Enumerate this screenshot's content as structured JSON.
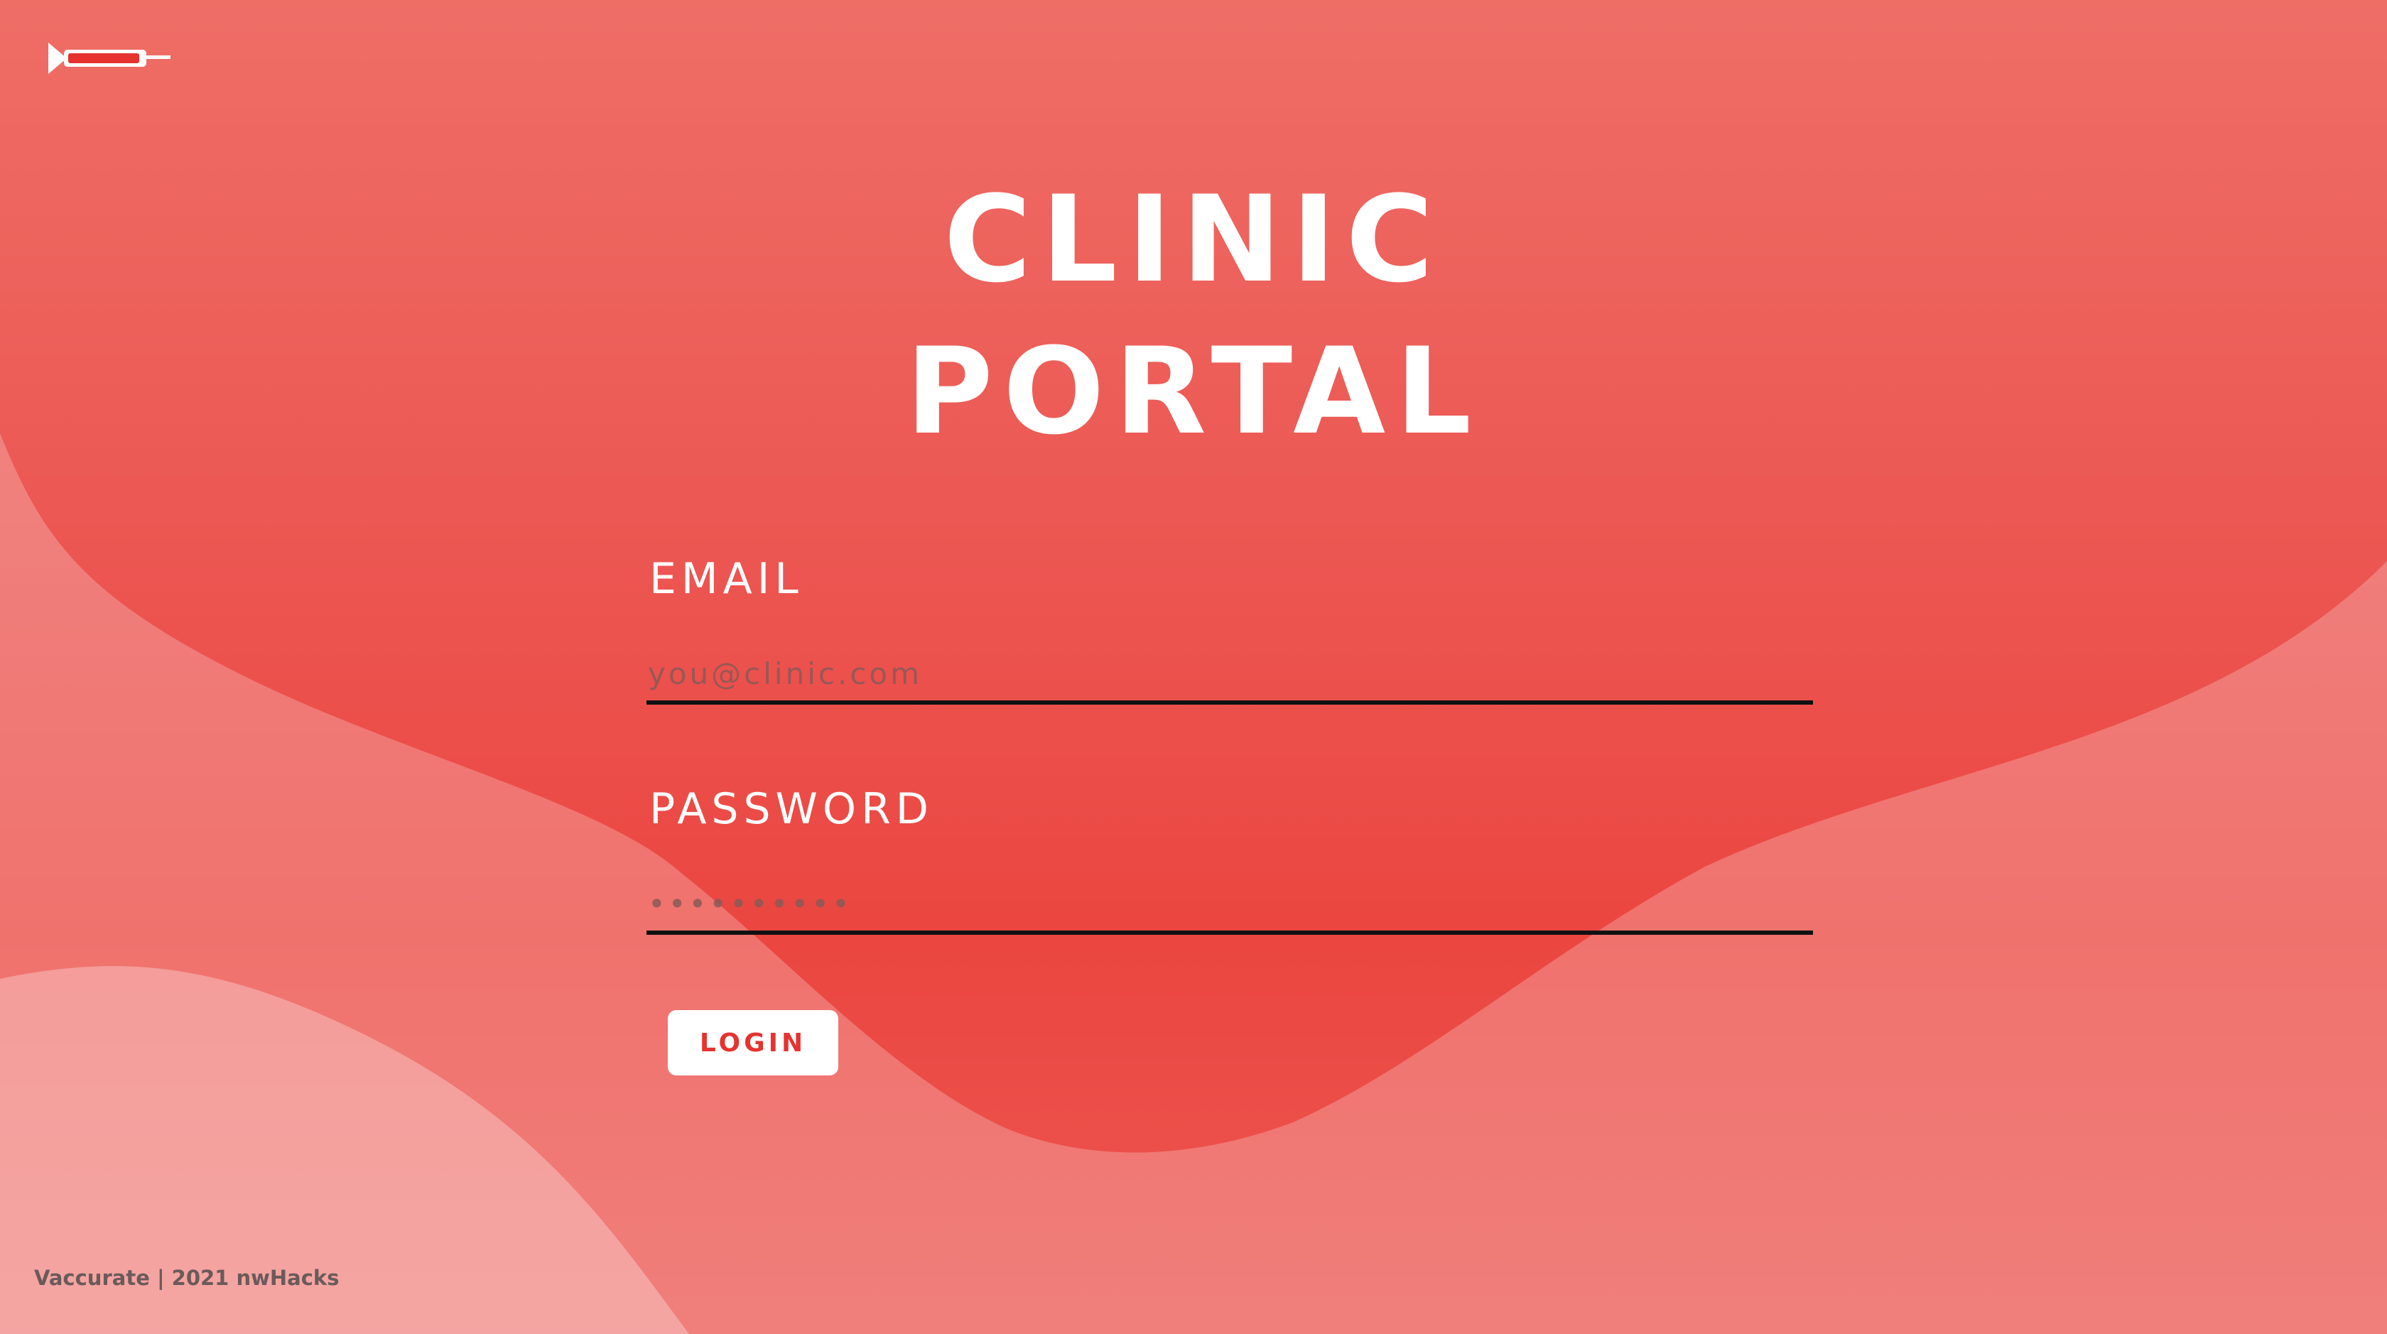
{
  "colors": {
    "primary_red": "#ec4a44",
    "button_bg": "#ffffff",
    "button_text": "#e5332f",
    "footer_text": "#6b5a5a"
  },
  "logo": {
    "icon": "syringe-icon"
  },
  "title": {
    "line1": "CLINIC",
    "line2": "PORTAL"
  },
  "form": {
    "email": {
      "label": "EMAIL",
      "placeholder": "you@clinic.com",
      "value": ""
    },
    "password": {
      "label": "PASSWORD",
      "placeholder": "••••••••••",
      "value": ""
    },
    "login_label": "LOGIN"
  },
  "footer": {
    "text": "Vaccurate | 2021 nwHacks"
  }
}
